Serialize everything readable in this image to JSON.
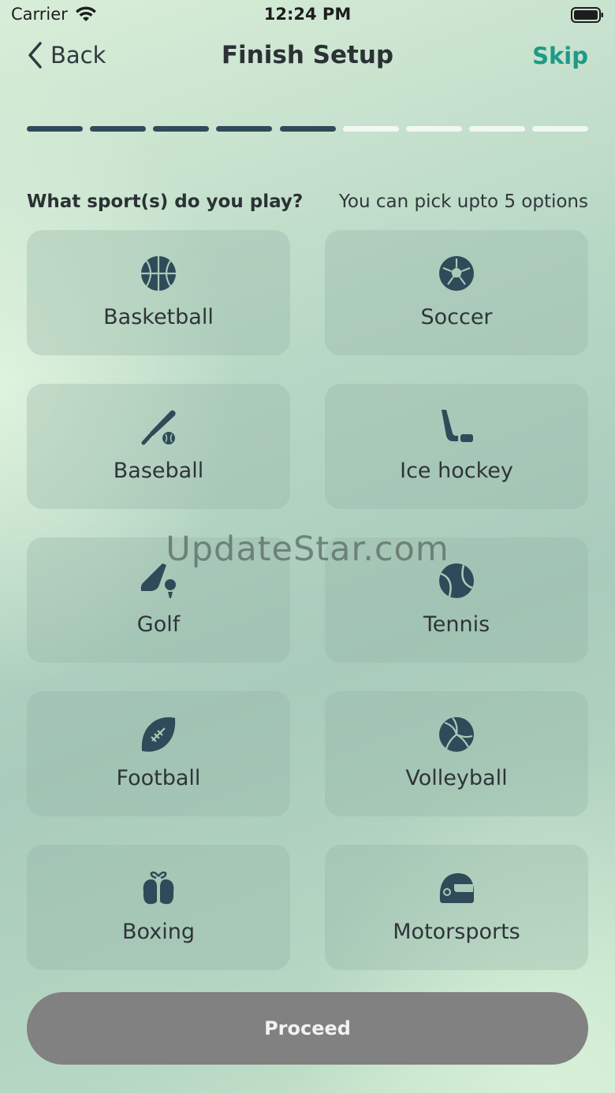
{
  "status_bar": {
    "carrier": "Carrier",
    "time": "12:24 PM"
  },
  "nav": {
    "back_label": "Back",
    "title": "Finish Setup",
    "skip_label": "Skip"
  },
  "progress": {
    "current_step": 5,
    "total_steps": 9
  },
  "question": {
    "text": "What sport(s) do you play?",
    "hint": "You can pick upto 5 options"
  },
  "sports": [
    {
      "label": "Basketball",
      "icon": "basketball-icon"
    },
    {
      "label": "Soccer",
      "icon": "soccer-ball-icon"
    },
    {
      "label": "Baseball",
      "icon": "baseball-icon"
    },
    {
      "label": "Ice hockey",
      "icon": "hockey-stick-icon"
    },
    {
      "label": "Golf",
      "icon": "golf-club-icon"
    },
    {
      "label": "Tennis",
      "icon": "tennis-ball-icon"
    },
    {
      "label": "Football",
      "icon": "football-icon"
    },
    {
      "label": "Volleyball",
      "icon": "volleyball-icon"
    },
    {
      "label": "Boxing",
      "icon": "boxing-gloves-icon"
    },
    {
      "label": "Motorsports",
      "icon": "racing-helmet-icon"
    }
  ],
  "watermark": "UpdateStar.com",
  "proceed_label": "Proceed",
  "colors": {
    "accent": "#1e9a86",
    "icon": "#2f4a58",
    "button": "#818181"
  }
}
